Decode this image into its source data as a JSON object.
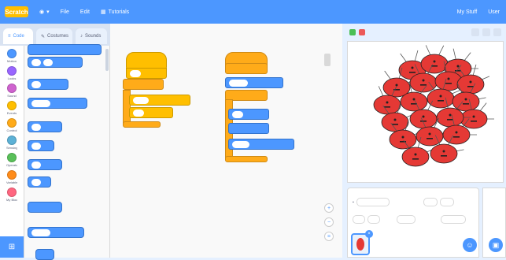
{
  "menubar": {
    "logo": "Scratch",
    "items": [
      "File",
      "Edit",
      "Tutorials"
    ],
    "right": [
      "My Stuff",
      "User"
    ]
  },
  "editor_tabs": [
    "Code",
    "Costumes",
    "Sounds"
  ],
  "categories": [
    {
      "name": "Motion",
      "color": "#4c97ff"
    },
    {
      "name": "Looks",
      "color": "#9966ff"
    },
    {
      "name": "Sound",
      "color": "#cf63cf"
    },
    {
      "name": "Events",
      "color": "#ffbf00"
    },
    {
      "name": "Control",
      "color": "#ffab19"
    },
    {
      "name": "Sensing",
      "color": "#5cb1d6"
    },
    {
      "name": "Operators",
      "color": "#59c059"
    },
    {
      "name": "Variables",
      "color": "#ff8c1a"
    },
    {
      "name": "My Blocks",
      "color": "#ff6680"
    }
  ],
  "colors": {
    "accent": "#4c97ff",
    "events": "#ffbf00",
    "control": "#ffab19",
    "sprite": "#e53935"
  },
  "icons": [
    "globe-icon",
    "green-flag-icon",
    "stop-icon",
    "zoom-in-icon",
    "zoom-out-icon",
    "zoom-reset-icon",
    "add-extension-icon",
    "choose-sprite-icon",
    "choose-backdrop-icon"
  ],
  "stage_sprites": {
    "count": 20
  }
}
